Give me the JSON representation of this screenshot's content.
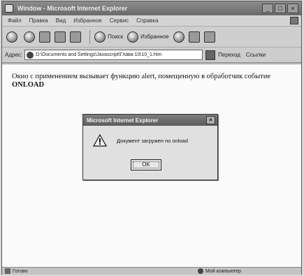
{
  "window": {
    "title": "Window - Microsoft Internet Explorer",
    "controls": [
      "_",
      "□",
      "×"
    ]
  },
  "menubar": {
    "items": [
      "Файл",
      "Правка",
      "Вид",
      "Избранное",
      "Сервис",
      "Справка"
    ]
  },
  "toolbar": {
    "back_label": "",
    "search_label": "Поиск",
    "favorites_label": "Избранное"
  },
  "addressbar": {
    "label": "Адрес:",
    "url": "D:\\Documents and Settings\\Javascript\\Глава 10\\10_1.htm",
    "go_label": "Переход",
    "links_label": "Ссылки"
  },
  "page": {
    "line1": "Окно с применением вызывает функцию alert, помещенную в обработчик событие",
    "line2": "ONLOAD"
  },
  "dialog": {
    "title": "Microsoft Internet Explorer",
    "message": "Документ загружен по onload",
    "ok_label": "OK",
    "close_label": "×"
  },
  "statusbar": {
    "left_text": "Готово",
    "right_text": "Мой компьютер"
  }
}
